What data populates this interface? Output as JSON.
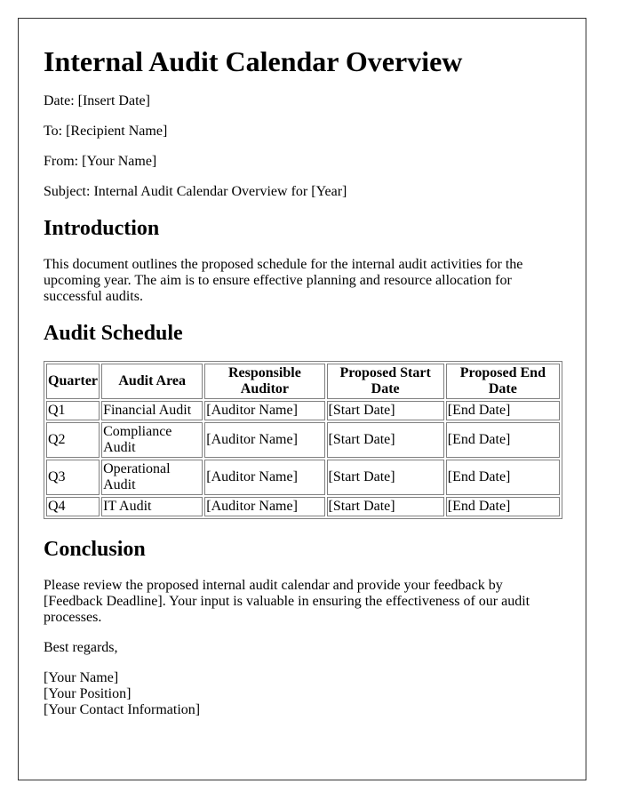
{
  "title": "Internal Audit Calendar Overview",
  "meta": {
    "date": "Date: [Insert Date]",
    "to": "To: [Recipient Name]",
    "from": "From: [Your Name]",
    "subject": "Subject: Internal Audit Calendar Overview for [Year]"
  },
  "introduction": {
    "heading": "Introduction",
    "text": "This document outlines the proposed schedule for the internal audit activities for the upcoming year. The aim is to ensure effective planning and resource allocation for successful audits."
  },
  "schedule": {
    "heading": "Audit Schedule",
    "columns": [
      "Quarter",
      "Audit Area",
      "Responsible Auditor",
      "Proposed Start Date",
      "Proposed End Date"
    ],
    "rows": [
      [
        "Q1",
        "Financial Audit",
        "[Auditor Name]",
        "[Start Date]",
        "[End Date]"
      ],
      [
        "Q2",
        "Compliance Audit",
        "[Auditor Name]",
        "[Start Date]",
        "[End Date]"
      ],
      [
        "Q3",
        "Operational Audit",
        "[Auditor Name]",
        "[Start Date]",
        "[End Date]"
      ],
      [
        "Q4",
        "IT Audit",
        "[Auditor Name]",
        "[Start Date]",
        "[End Date]"
      ]
    ]
  },
  "conclusion": {
    "heading": "Conclusion",
    "text": "Please review the proposed internal audit calendar and provide your feedback by [Feedback Deadline]. Your input is valuable in ensuring the effectiveness of our audit processes.",
    "closing": "Best regards,",
    "signature": [
      "[Your Name]",
      "[Your Position]",
      "[Your Contact Information]"
    ]
  }
}
